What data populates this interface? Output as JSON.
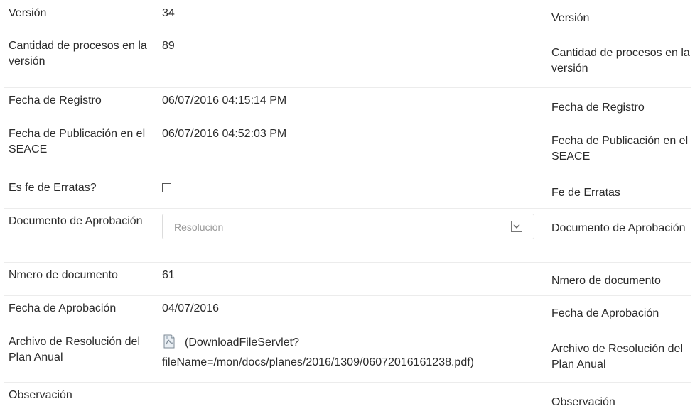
{
  "left": {
    "version_label": "Versión",
    "version_value": "34",
    "procesos_label": "Cantidad de procesos en la versión",
    "procesos_value": "89",
    "registro_label": "Fecha de Registro",
    "registro_value": "06/07/2016 04:15:14 PM",
    "publicacion_label": "Fecha de Publicación en el SEACE",
    "publicacion_value": "06/07/2016 04:52:03 PM",
    "erratas_label": "Es fe de Erratas?",
    "erratas_checked": false,
    "documento_label": "Documento de Aprobación",
    "documento_select_value": "Resolución",
    "numero_label": "Nmero de documento",
    "numero_value": "61",
    "aprobacion_label": "Fecha de Aprobación",
    "aprobacion_value": "04/07/2016",
    "archivo_label": "Archivo de Resolución del Plan Anual",
    "archivo_link_line1": "(DownloadFileServlet?",
    "archivo_link_line2": "fileName=/mon/docs/planes/2016/1309/06072016161238.pdf)",
    "observacion_label": "Observación"
  },
  "right": {
    "version_label": "Versión",
    "procesos_label": "Cantidad de procesos en la versión",
    "registro_label": "Fecha de Registro",
    "publicacion_label": "Fecha de Publicación en el SEACE",
    "erratas_label": "Fe de Erratas",
    "documento_label": "Documento de Aprobación",
    "numero_label": "Nmero de documento",
    "aprobacion_label": "Fecha de Aprobación",
    "archivo_label": "Archivo de Resolución del Plan Anual",
    "observacion_label": "Observación"
  },
  "icons": {
    "file": "pdf-file-icon",
    "dropdown": "chevron-down-icon",
    "checkbox": "checkbox-unchecked"
  },
  "colors": {
    "text": "#2b2b2b",
    "muted": "#9a9a9a",
    "border": "#dcdcdc",
    "separator": "#ececec"
  }
}
